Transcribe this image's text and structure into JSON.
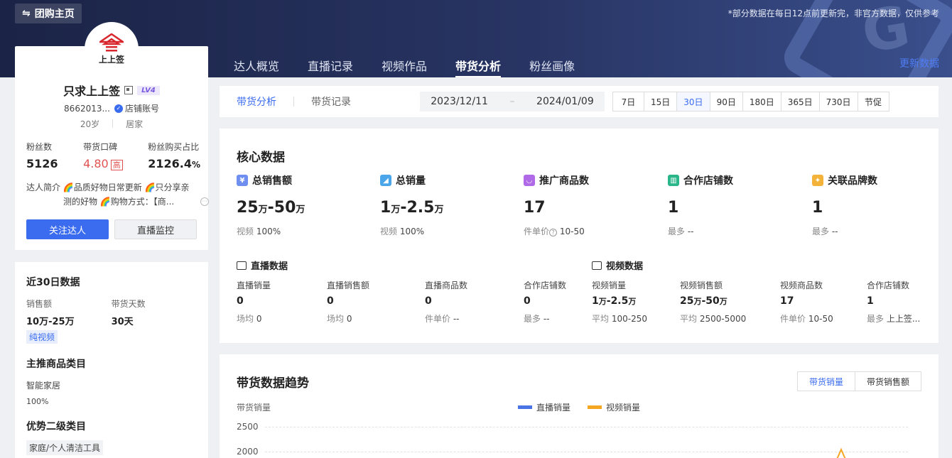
{
  "header": {
    "back_label": "团购主页",
    "notice": "*部分数据在每日12点前更新完，非官方数据，仅供参考",
    "update_label": "更新数据",
    "tabs": [
      "达人概览",
      "直播记录",
      "视频作品",
      "带货分析",
      "粉丝画像"
    ],
    "active_tab": "带货分析"
  },
  "profile": {
    "logo_text": "上上签",
    "name": "只求上上签",
    "level": "LV4",
    "id": "8662013...",
    "account_type": "店铺账号",
    "age": "20岁",
    "category": "居家",
    "stats": [
      {
        "label": "粉丝数",
        "value": "5126"
      },
      {
        "label": "带货口碑",
        "value": "4.80",
        "tag": "高"
      },
      {
        "label": "粉丝购买占比",
        "value": "2126.4",
        "unit": "%"
      }
    ],
    "intro_label": "达人简介",
    "intro_line1": "🌈品质好物日常更新 🌈只分享亲",
    "intro_line2": "测的好物 🌈购物方式：【商...",
    "follow_button": "关注达人",
    "monitor_button": "直播监控"
  },
  "side": {
    "recent_title": "近30日数据",
    "sales_label": "销售额",
    "sales_value": "10万-25万",
    "days_label": "带货天数",
    "days_value": "30天",
    "pill": "纯视频",
    "main_cat_title": "主推商品类目",
    "main_cat": "智能家居",
    "main_cat_pct": "100%",
    "second_cat_title": "优势二级类目",
    "second_cat": "家庭/个人清洁工具"
  },
  "subnav": {
    "tabs": [
      "带货分析",
      "带货记录"
    ],
    "date_start": "2023/12/11",
    "date_sep": "–",
    "date_end": "2024/01/09",
    "periods": [
      "7日",
      "15日",
      "30日",
      "90日",
      "180日",
      "365日",
      "730日",
      "节促"
    ],
    "active_period": "30日"
  },
  "core": {
    "title": "核心数据",
    "metrics": [
      {
        "label": "总销售额",
        "value_a": "25",
        "unit_a": "万",
        "sep": "-",
        "value_b": "50",
        "unit_b": "万",
        "sub_label": "视频",
        "sub_value": "100%"
      },
      {
        "label": "总销量",
        "value_a": "1",
        "unit_a": "万",
        "sep": "-",
        "value_b": "2.5",
        "unit_b": "万",
        "sub_label": "视频",
        "sub_value": "100%"
      },
      {
        "label": "推广商品数",
        "value": "17",
        "sub_label": "件单价",
        "sub_value": "10-50"
      },
      {
        "label": "合作店铺数",
        "value": "1",
        "sub_label": "最多",
        "sub_value": "--"
      },
      {
        "label": "关联品牌数",
        "value": "1",
        "sub_label": "最多",
        "sub_value": "--"
      }
    ],
    "live_title": "直播数据",
    "video_title": "视频数据",
    "live": [
      {
        "label": "直播销量",
        "value": "0",
        "sub_label": "场均",
        "sub_value": "0"
      },
      {
        "label": "直播销售额",
        "value": "0",
        "sub_label": "场均",
        "sub_value": "0"
      },
      {
        "label": "直播商品数",
        "value": "0",
        "sub_label": "件单价",
        "sub_value": "--"
      },
      {
        "label": "合作店铺数",
        "value": "0",
        "sub_label": "最多",
        "sub_value": "--"
      }
    ],
    "video": [
      {
        "label": "视频销量",
        "value_a": "1",
        "unit_a": "万",
        "sep": "-",
        "value_b": "2.5",
        "unit_b": "万",
        "sub_label": "平均",
        "sub_value": "100-250"
      },
      {
        "label": "视频销售额",
        "value_a": "25",
        "unit_a": "万",
        "sep": "-",
        "value_b": "50",
        "unit_b": "万",
        "sub_label": "平均",
        "sub_value": "2500-5000"
      },
      {
        "label": "视频商品数",
        "value": "17",
        "sub_label": "件单价",
        "sub_value": "10-50"
      },
      {
        "label": "合作店铺数",
        "value": "1",
        "sub_label": "最多",
        "sub_value": "上上签..."
      }
    ]
  },
  "trend": {
    "title": "带货数据趋势",
    "toggles": [
      "带货销量",
      "带货销售额"
    ],
    "active_toggle": "带货销量",
    "ylabel": "带货销量",
    "legend": [
      {
        "name": "直播销量",
        "color": "#4a74e6"
      },
      {
        "name": "视频销量",
        "color": "#f5a623"
      }
    ],
    "yticks": [
      "2500",
      "2000"
    ]
  }
}
